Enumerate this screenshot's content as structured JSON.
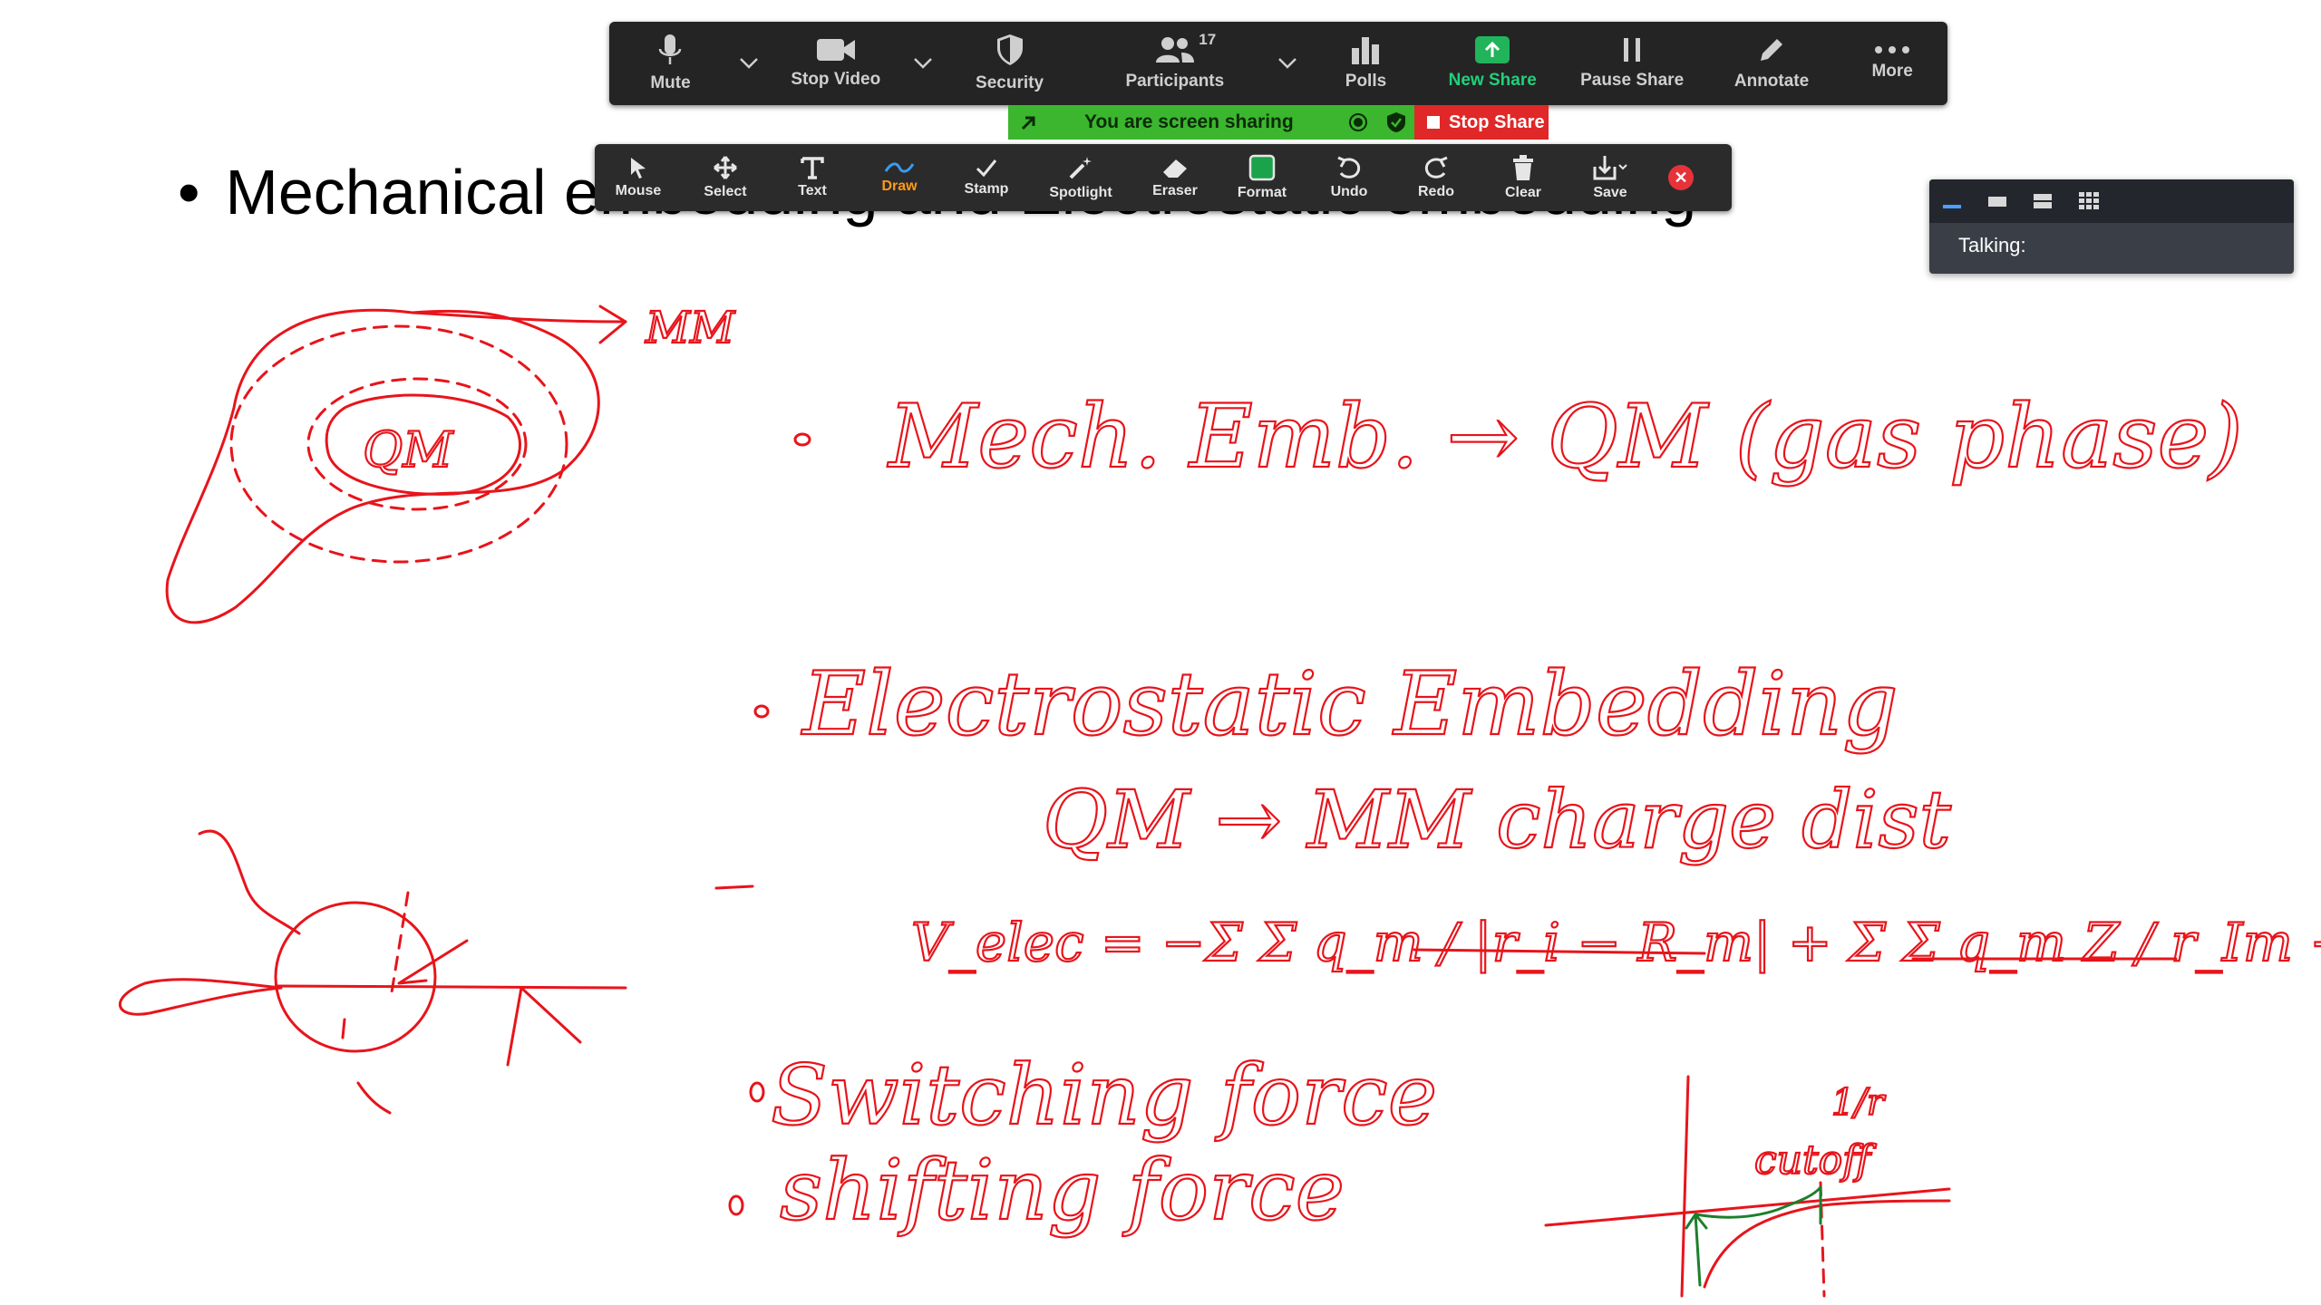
{
  "toolbar": {
    "mute": "Mute",
    "stop_video": "Stop Video",
    "security": "Security",
    "participants": "Participants",
    "participants_count": "17",
    "polls": "Polls",
    "new_share": "New Share",
    "pause_share": "Pause Share",
    "annotate": "Annotate",
    "more": "More"
  },
  "sharing": {
    "banner": "You are screen sharing",
    "stop": "Stop Share"
  },
  "annotate_toolbar": {
    "mouse": "Mouse",
    "select": "Select",
    "text": "Text",
    "draw": "Draw",
    "stamp": "Stamp",
    "spotlight": "Spotlight",
    "eraser": "Eraser",
    "format": "Format",
    "undo": "Undo",
    "redo": "Redo",
    "clear": "Clear",
    "save": "Save"
  },
  "talking_panel": {
    "label": "Talking:"
  },
  "slide": {
    "bullet": "•",
    "title": "Mechanical embedding and Electrostatic embedding"
  },
  "ink": {
    "mm": "MM",
    "qm": "QM",
    "mech": "Mech. Emb. → QM (gas phase)",
    "elec": "Electrostatic Embedding",
    "qm_mm": "QM → MM charge dist",
    "formula": "V_elec = −Σ Σ q_m / |r_i − R_m| + Σ Σ q_m Z / r_Im − r_I",
    "switching": "Switching force",
    "shifting": "shifting force",
    "one_r": "1/r",
    "cutoff": "cutoff"
  },
  "colors": {
    "ink": "#e8141b",
    "toolbar_bg": "#242424",
    "banner_green": "#3bb62e",
    "stop_red": "#e02828"
  }
}
